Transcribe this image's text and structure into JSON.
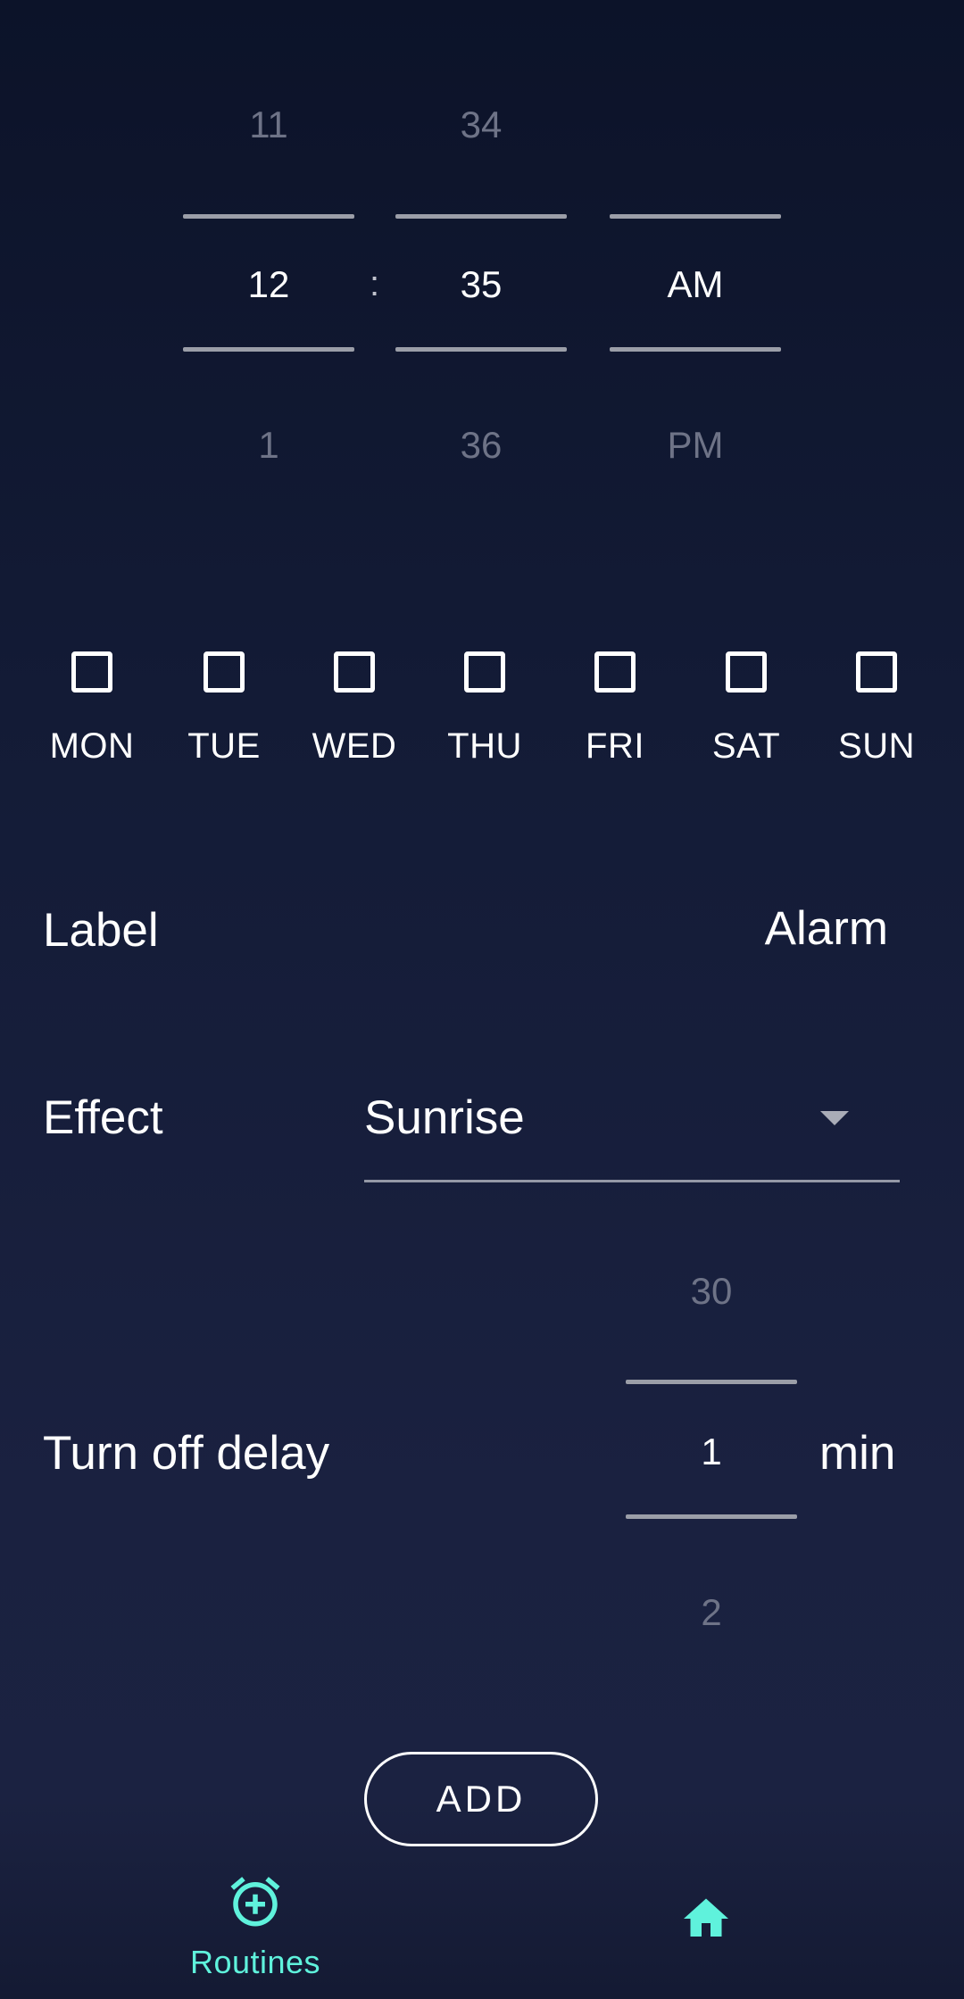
{
  "time_picker": {
    "hour": {
      "prev": "11",
      "selected": "12",
      "next": "1"
    },
    "separator": ":",
    "minute": {
      "prev": "34",
      "selected": "35",
      "next": "36"
    },
    "period": {
      "selected": "AM",
      "next": "PM"
    }
  },
  "days": [
    {
      "label": "MON",
      "checked": false
    },
    {
      "label": "TUE",
      "checked": false
    },
    {
      "label": "WED",
      "checked": false
    },
    {
      "label": "THU",
      "checked": false
    },
    {
      "label": "FRI",
      "checked": false
    },
    {
      "label": "SAT",
      "checked": false
    },
    {
      "label": "SUN",
      "checked": false
    }
  ],
  "label_row": {
    "label": "Label",
    "value": "Alarm"
  },
  "effect_row": {
    "label": "Effect",
    "value": "Sunrise"
  },
  "delay_row": {
    "label": "Turn off delay",
    "prev": "30",
    "selected": "1",
    "next": "2",
    "unit": "min"
  },
  "add_button": {
    "label": "ADD"
  },
  "bottom_nav": {
    "routines": {
      "label": "Routines",
      "icon": "alarm-add-icon"
    },
    "home": {
      "icon": "home-icon"
    }
  },
  "colors": {
    "accent": "#5ff2dc",
    "background_top": "#0c1329",
    "background_bottom": "#1b2241",
    "dim_text": "#6e7387",
    "divider": "#9b9ea8"
  }
}
